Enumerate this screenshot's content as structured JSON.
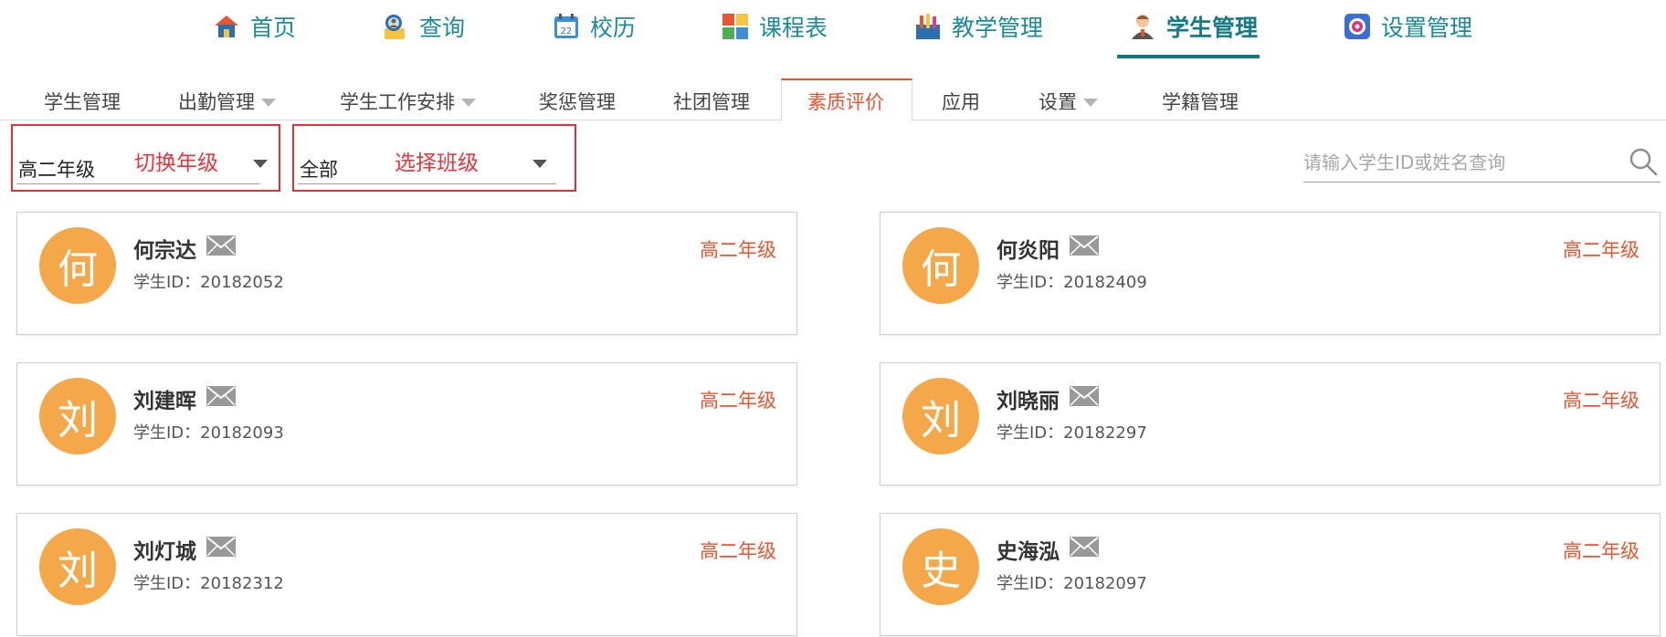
{
  "topnav": {
    "items": [
      {
        "label": "首页",
        "icon": "home-icon"
      },
      {
        "label": "查询",
        "icon": "search-person-icon"
      },
      {
        "label": "校历",
        "icon": "calendar-icon"
      },
      {
        "label": "课程表",
        "icon": "timetable-icon"
      },
      {
        "label": "教学管理",
        "icon": "teaching-icon"
      },
      {
        "label": "学生管理",
        "icon": "student-icon"
      },
      {
        "label": "设置管理",
        "icon": "settings-icon"
      }
    ],
    "active": "学生管理"
  },
  "subtabs": {
    "items": [
      {
        "label": "学生管理",
        "has_dropdown": false
      },
      {
        "label": "出勤管理",
        "has_dropdown": true
      },
      {
        "label": "学生工作安排",
        "has_dropdown": true
      },
      {
        "label": "奖惩管理",
        "has_dropdown": false
      },
      {
        "label": "社团管理",
        "has_dropdown": false
      },
      {
        "label": "素质评价",
        "has_dropdown": false
      },
      {
        "label": "应用",
        "has_dropdown": false
      },
      {
        "label": "设置",
        "has_dropdown": true
      },
      {
        "label": "学籍管理",
        "has_dropdown": false
      }
    ],
    "active": "素质评价"
  },
  "filters": {
    "grade": {
      "value": "高二年级",
      "hint": "切换年级"
    },
    "class": {
      "value": "全部",
      "hint": "选择班级"
    }
  },
  "search": {
    "placeholder": "请输入学生ID或姓名查询"
  },
  "students": [
    {
      "avatar": "何",
      "name": "何宗达",
      "id_label": "学生ID：20182052",
      "grade": "高二年级"
    },
    {
      "avatar": "何",
      "name": "何炎阳",
      "id_label": "学生ID：20182409",
      "grade": "高二年级"
    },
    {
      "avatar": "刘",
      "name": "刘建晖",
      "id_label": "学生ID：20182093",
      "grade": "高二年级"
    },
    {
      "avatar": "刘",
      "name": "刘晓丽",
      "id_label": "学生ID：20182297",
      "grade": "高二年级"
    },
    {
      "avatar": "刘",
      "name": "刘灯城",
      "id_label": "学生ID：20182312",
      "grade": "高二年级"
    },
    {
      "avatar": "史",
      "name": "史海泓",
      "id_label": "学生ID：20182097",
      "grade": "高二年级"
    }
  ],
  "colors": {
    "nav_text": "#1a8a9a",
    "accent_orange": "#e8552f",
    "avatar_bg": "#f5a84a",
    "annotation_red": "#e0303a"
  }
}
